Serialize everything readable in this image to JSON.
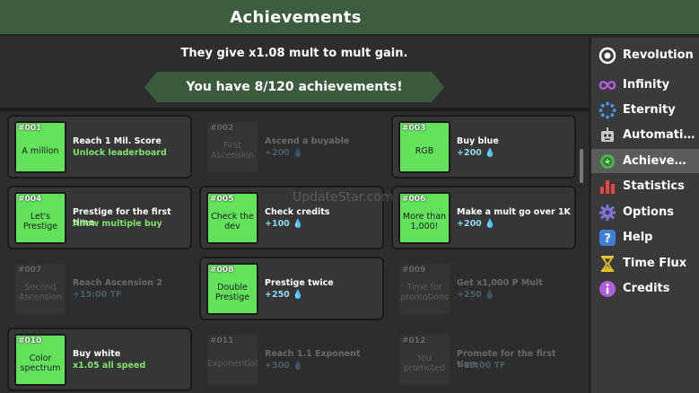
{
  "header": {
    "title": "Achievements"
  },
  "subtitle": "They give x1.08 mult to mult gain.",
  "ribbon": "You have 8/120 achievements!",
  "watermark": "UpdateStar.com",
  "colors": {
    "header": "#3c5e3e",
    "unlocked_badge": "#63e35b",
    "reward_green": "#7fe36a",
    "reward_gem": "#8fd8f0",
    "sidebar": "#3a3a3a"
  },
  "achievements": [
    {
      "num": "#001",
      "name": "A million",
      "desc": "Reach 1 Mil. Score",
      "reward": "Unlock leaderboard",
      "unlocked": true
    },
    {
      "num": "#002",
      "name": "First Ascension",
      "desc": "Ascend a buyable",
      "reward": "+200 💧",
      "unlocked": false
    },
    {
      "num": "#003",
      "name": "RGB",
      "desc": "Buy blue",
      "reward": "+200 💧",
      "unlocked": true
    },
    {
      "num": "#004",
      "name": "Let's Prestige",
      "desc": "Prestige for the first time",
      "reward": "Allow multiple buy",
      "unlocked": true
    },
    {
      "num": "#005",
      "name": "Check the dev",
      "desc": "Check credits",
      "reward": "+100 💧",
      "unlocked": true
    },
    {
      "num": "#006",
      "name": "More than 1,000!",
      "desc": "Make a mult go over 1K",
      "reward": "+200 💧",
      "unlocked": true
    },
    {
      "num": "#007",
      "name": "Second Ascension",
      "desc": "Reach Ascension 2",
      "reward": "+15:00 TF",
      "unlocked": false
    },
    {
      "num": "#008",
      "name": "Double Prestige",
      "desc": "Prestige twice",
      "reward": "+250 💧",
      "unlocked": true
    },
    {
      "num": "#009",
      "name": "Time for promotions",
      "desc": "Get x1,000 P Mult",
      "reward": "+250 💧",
      "unlocked": false
    },
    {
      "num": "#010",
      "name": "Color spectrum",
      "desc": "Buy white",
      "reward": "x1.05 all speed",
      "unlocked": true
    },
    {
      "num": "#011",
      "name": "Exponential",
      "desc": "Reach 1.1 Exponent",
      "reward": "+300 💧",
      "unlocked": false
    },
    {
      "num": "#012",
      "name": "You promoted",
      "desc": "Promote for the first time",
      "reward": "+15:00 TF",
      "unlocked": false
    }
  ],
  "sidebar": {
    "items": [
      {
        "label": "Revolution",
        "icon": "ring-icon",
        "active": false
      },
      {
        "label": "Infinity",
        "icon": "infinity-icon",
        "active": false
      },
      {
        "label": "Eternity",
        "icon": "dots-ring-icon",
        "active": false
      },
      {
        "label": "Automations",
        "icon": "robot-icon",
        "active": false
      },
      {
        "label": "Achievem...",
        "icon": "medal-icon",
        "active": true
      },
      {
        "label": "Statistics",
        "icon": "bar-chart-icon",
        "active": false
      },
      {
        "label": "Options",
        "icon": "gear-icon",
        "active": false
      },
      {
        "label": "Help",
        "icon": "question-icon",
        "active": false
      },
      {
        "label": "Time Flux",
        "icon": "hourglass-icon",
        "active": false
      },
      {
        "label": "Credits",
        "icon": "info-icon",
        "active": false
      }
    ]
  }
}
